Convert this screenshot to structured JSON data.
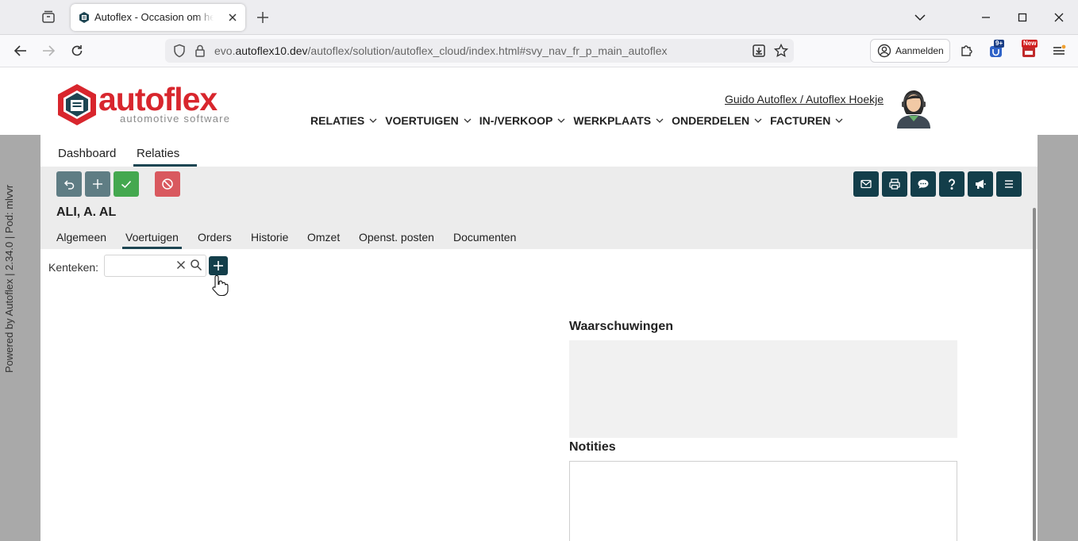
{
  "browser": {
    "tab_title": "Autoflex - Occasion om het Hoekje",
    "url_prefix": "evo.",
    "url_domain": "autoflex10.dev",
    "url_path": "/autoflex/solution/autoflex_cloud/index.html#svy_nav_fr_p_main_autoflex",
    "signin_label": "Aanmelden",
    "ext_badge_count": "9+",
    "ext_badge_new": "New"
  },
  "app": {
    "logo_word": "autoflex",
    "logo_tagline": "automotive software",
    "user_link": "Guido Autoflex / Autoflex Hoekje",
    "menu": [
      {
        "label": "RELATIES"
      },
      {
        "label": "VOERTUIGEN"
      },
      {
        "label": "IN-/VERKOOP"
      },
      {
        "label": "WERKPLAATS"
      },
      {
        "label": "ONDERDELEN"
      },
      {
        "label": "FACTUREN"
      }
    ],
    "powered_by": "Powered by Autoflex | 2.34.0 | Pod: mlvvr"
  },
  "content": {
    "crumbs": [
      "Dashboard",
      "Relaties"
    ],
    "relation_name": "ALI, A. AL",
    "subtabs": [
      "Algemeen",
      "Voertuigen",
      "Orders",
      "Historie",
      "Omzet",
      "Openst. posten",
      "Documenten"
    ],
    "active_subtab": "Voertuigen",
    "kenteken_label": "Kenteken:",
    "kenteken_value": "",
    "warnings_title": "Waarschuwingen",
    "notes_title": "Notities",
    "notes_value": ""
  },
  "colors": {
    "brand_red": "#d8262d",
    "dark_teal": "#133e4a",
    "action_green": "#44a84f",
    "action_red": "#d9595f",
    "action_grey": "#5f7d84"
  }
}
